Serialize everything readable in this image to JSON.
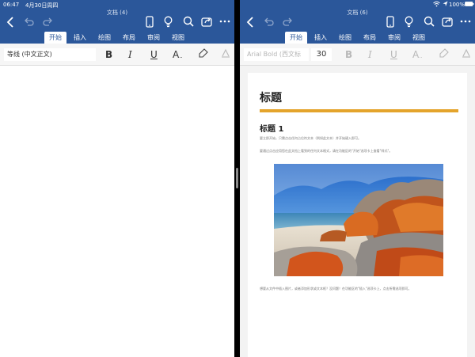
{
  "status": {
    "time": "06:47",
    "date": "4月30日周四",
    "battery": "100%"
  },
  "colors": {
    "ribbon_blue": "#2b579a",
    "heading_rule": "#e4a42c"
  },
  "left": {
    "doc_title": "文档 (4)",
    "tabs": [
      {
        "label": "开始",
        "active": true
      },
      {
        "label": "插入"
      },
      {
        "label": "绘图"
      },
      {
        "label": "布局"
      },
      {
        "label": "审阅"
      },
      {
        "label": "视图"
      }
    ],
    "font_name": "等线 (中文正文)",
    "ribbon": {
      "bold": "B",
      "italic": "I",
      "underline": "U",
      "font_color": "A"
    }
  },
  "right": {
    "doc_title": "文档 (6)",
    "tabs": [
      {
        "label": "开始",
        "active": true
      },
      {
        "label": "插入"
      },
      {
        "label": "绘图"
      },
      {
        "label": "布局"
      },
      {
        "label": "审阅"
      },
      {
        "label": "视图"
      }
    ],
    "font_name": "Arial Bold (西文标",
    "font_size": "30",
    "ribbon": {
      "bold": "B",
      "italic": "I",
      "underline": "U",
      "font_color": "A"
    },
    "document": {
      "title": "标题",
      "heading1": "标题 1",
      "para1": "要立即开始，只需点击任何占位符文本（例如此文本）并开始键入即可。",
      "para2": "要通过点击应用您在此文档上看到的任何文本格式，请在功能区的\"开始\"选项卡上查看\"样式\"。",
      "para3": "想要从文件中插入图片，或者添加形状或文本框？没问题！在功能区的\"插入\"选项卡上，点击所需选项即可。"
    }
  },
  "icons": [
    "back-icon",
    "undo-icon",
    "redo-icon",
    "phone-layout-icon",
    "lightbulb-icon",
    "search-icon",
    "share-icon",
    "more-icon",
    "highlighter-icon",
    "clear-format-icon",
    "wifi-icon",
    "location-icon",
    "battery-icon"
  ]
}
